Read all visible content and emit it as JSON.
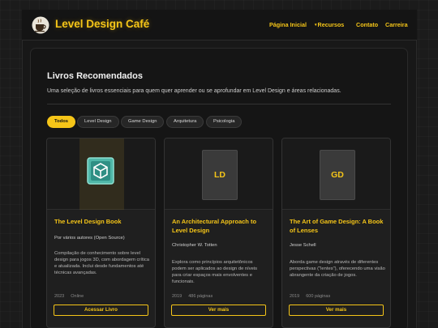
{
  "header": {
    "brand": "Level Design Café",
    "nav": [
      {
        "label": "Página Inicial"
      },
      {
        "label": "Recursos",
        "caret": "▾"
      },
      {
        "label": "Contato"
      },
      {
        "label": "Carreira"
      }
    ]
  },
  "main": {
    "title": "Livros Recomendados",
    "subtitle": "Uma seleção de livros essenciais para quem quer aprender ou se aprofundar em Level Design e áreas relacionadas.",
    "filters": [
      {
        "label": "Todos",
        "active": true
      },
      {
        "label": "Level Design",
        "active": false
      },
      {
        "label": "Game Design",
        "active": false
      },
      {
        "label": "Arquitetura",
        "active": false
      },
      {
        "label": "Psicologia",
        "active": false
      }
    ],
    "books": [
      {
        "cover": "book-cube-icon",
        "title": "The Level Design Book",
        "author": "Por vários autores (Open Source)",
        "description": "Compilação de conhecimento sobre level design para jogos 3D, com abordagem crítica e atualizada. Inclui desde fundamentos até técnicas avançadas.",
        "year": "2023",
        "extra": "Online",
        "button": "Acessar Livro"
      },
      {
        "cover_text": "LD",
        "title": "An Architectural Approach to Level Design",
        "author": "Christopher W. Totten",
        "description": "Explora como princípios arquitetônicos podem ser aplicados ao design de níveis para criar espaços mais envolventes e funcionais.",
        "year": "2019",
        "extra": "486 páginas",
        "button": "Ver mais"
      },
      {
        "cover_text": "GD",
        "title": "The Art of Game Design: A Book of Lenses",
        "author": "Jesse Schell",
        "description": "Aborda game design através de diferentes perspectivas (\"lentes\"), oferecendo uma visão abrangente da criação de jogos.",
        "year": "2019",
        "extra": "600 páginas",
        "button": "Ver mais"
      }
    ]
  },
  "colors": {
    "accent": "#f5c518",
    "background": "#1b1b1b",
    "card": "#1f1f1f"
  }
}
